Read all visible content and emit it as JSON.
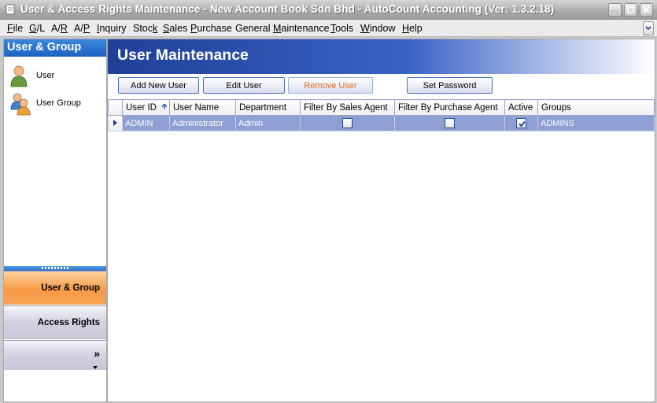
{
  "window": {
    "title": "User & Access Rights Maintenance - New Account Book Sdn Bhd - AutoCount Accounting (Ver: 1.3.2.18)"
  },
  "menu": [
    {
      "u": "F",
      "rest": "ile"
    },
    {
      "u": "G",
      "rest": "/L"
    },
    {
      "pre": "A/",
      "u": "R",
      "rest": ""
    },
    {
      "pre": "A/",
      "u": "P",
      "rest": ""
    },
    {
      "u": "I",
      "rest": "nquiry"
    },
    {
      "pre": "Stoc",
      "u": "k",
      "rest": ""
    },
    {
      "u": "S",
      "rest": "ales"
    },
    {
      "u": "P",
      "rest": "urchase"
    },
    {
      "pre": "General ",
      "u": "M",
      "rest": "aintenance"
    },
    {
      "u": "T",
      "rest": "ools"
    },
    {
      "u": "W",
      "rest": "indow"
    },
    {
      "u": "H",
      "rest": "elp"
    }
  ],
  "left_panel": {
    "header": "User & Group",
    "items": [
      "User",
      "User Group"
    ],
    "nav": {
      "user_group": "User & Group",
      "access_rights": "Access Rights",
      "more": "»"
    }
  },
  "main": {
    "title": "User Maintenance",
    "buttons": {
      "add": "Add New User",
      "edit": "Edit User",
      "remove": "Remove User",
      "password": "Set Password"
    },
    "columns": [
      "User ID",
      "User Name",
      "Department",
      "Filter By Sales Agent",
      "Filter By Purchase Agent",
      "Active",
      "Groups"
    ],
    "rows": [
      {
        "user_id": "ADMIN",
        "user_name": "Administrator",
        "department": "Admin",
        "filter_sales": false,
        "filter_purchase": false,
        "active": true,
        "groups": "ADMINS"
      }
    ]
  },
  "colors": {
    "title_bar": "#a9a9a9",
    "banner": "#2c4fae",
    "selected_row": "#8f9fd3",
    "active_nav": "#f79a45"
  },
  "icons": {
    "sort": "arrow-up-icon",
    "user": "user-icon",
    "group": "user-group-icon"
  }
}
